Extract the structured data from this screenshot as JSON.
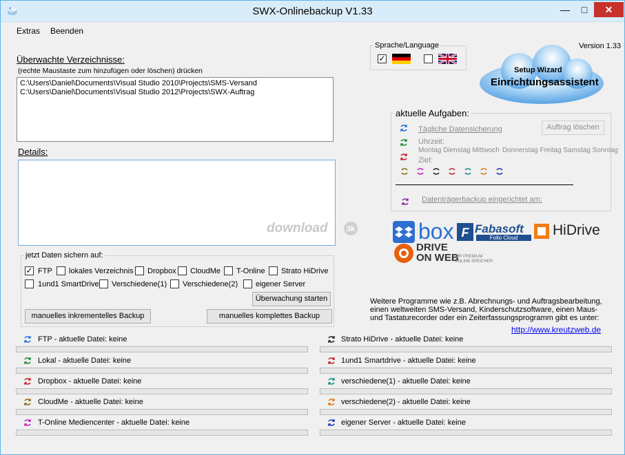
{
  "window": {
    "title": "SWX-Onlinebackup V1.33",
    "min": "—",
    "max": "□",
    "close": "✕"
  },
  "menu": [
    "Extras",
    "Beenden"
  ],
  "version": "Version 1.33",
  "watched": {
    "title": "Überwachte Verzeichnisse:",
    "hint": "(rechte Maustaste zum hinzufügen oder löschen) drücken",
    "paths": [
      "C:\\Users\\Daniel\\Documents\\Visual Studio 2010\\Projects\\SMS-Versand",
      "C:\\Users\\Daniel\\Documents\\Visual Studio 2012\\Projects\\SWX-Auftrag"
    ]
  },
  "details": {
    "title": "Details:",
    "watermark": "download"
  },
  "language": {
    "label": "Sprache/Language",
    "de_checked": "✓",
    "en_checked": ""
  },
  "wizard": {
    "line1": "Setup Wizard",
    "line2": "Einrichtungsassistent"
  },
  "tasks": {
    "title": "aktuelle Aufgaben:",
    "task1": "Tägliche Datensicherung",
    "delete_btn": "Auftrag löschen",
    "time_label": "Uhrzeit:",
    "days": "Montag Dienstag Mittwoch",
    "days2": "Donnerstag Freitag Samstag Sonntag",
    "target_label": "Ziel:",
    "drive_backup": "Datenträgerbackup eingerichtet am:"
  },
  "logos": {
    "box": "box",
    "fabasoft": "Fabasoft",
    "fabasoft_sub": "Folio Cloud",
    "hidrive": "HiDrive",
    "dow1": "DRIVE",
    "dow2": "ON WEB",
    "dow_sub1": "IHR PREMIUM",
    "dow_sub2": "ONLINE-SPEICHER"
  },
  "targets": {
    "title": "jetzt Daten sichern auf:",
    "items": [
      {
        "label": "FTP",
        "checked": "✓"
      },
      {
        "label": "lokales Verzeichnis",
        "checked": ""
      },
      {
        "label": "Dropbox",
        "checked": ""
      },
      {
        "label": "CloudMe",
        "checked": ""
      },
      {
        "label": "T-Online",
        "checked": ""
      },
      {
        "label": "Strato HiDrive",
        "checked": ""
      },
      {
        "label": "1und1 SmartDrive",
        "checked": ""
      },
      {
        "label": "Verschiedene(1)",
        "checked": ""
      },
      {
        "label": "Verschiedene(2)",
        "checked": ""
      },
      {
        "label": "eigener Server",
        "checked": ""
      }
    ],
    "watch_btn": "Überwachung starten",
    "inc_btn": "manuelles inkrementelles Backup",
    "full_btn": "manuelles komplettes Backup"
  },
  "promo": {
    "lines": [
      "Weitere Programme wie z.B. Abrechnungs- und Auftragsbearbeitung,",
      "einen weltweiten SMS-Versand, Kinderschutzsoftware, einen Maus-",
      "und Tastaturecorder oder ein Zeiterfassungsprogramm gibt es unter:"
    ],
    "url": "http://www.kreutzweb.de"
  },
  "status": {
    "left": [
      {
        "label": "FTP - aktuelle Datei:  keine",
        "color": "#2a6fd6"
      },
      {
        "label": "Lokal - aktuelle Datei: keine",
        "color": "#1f8a3a"
      },
      {
        "label": "Dropbox - aktuelle Datei:  keine",
        "color": "#c8202a"
      },
      {
        "label": "CloudMe - aktuelle Datei:  keine",
        "color": "#8a6a10"
      },
      {
        "label": "T-Online Mediencenter - aktuelle Datei:  keine",
        "color": "#c020c0"
      }
    ],
    "right": [
      {
        "label": "Strato HiDrive - aktuelle Datei:  keine",
        "color": "#222222"
      },
      {
        "label": "1und1 Smartdrive - aktuelle Datei:  keine",
        "color": "#c8202a"
      },
      {
        "label": "verschiedene(1) - aktuelle Datei:  keine",
        "color": "#1a8a8a"
      },
      {
        "label": "verschiedene(2) - aktuelle Datei:  keine",
        "color": "#e07818"
      },
      {
        "label": "eigener Server - aktuelle Datei:  keine",
        "color": "#1a3ab8"
      }
    ]
  }
}
